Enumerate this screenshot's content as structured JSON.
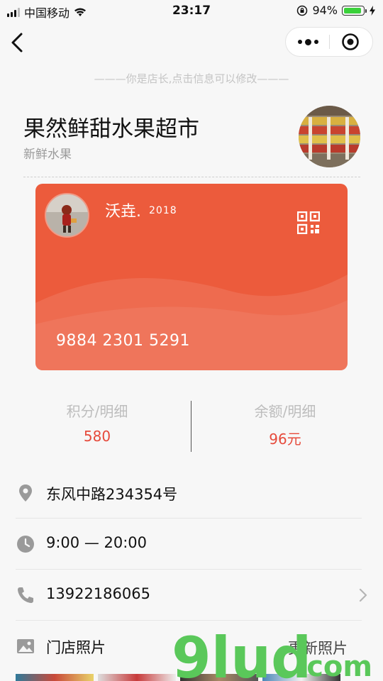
{
  "status_bar": {
    "carrier": "中国移动",
    "time": "23:17",
    "battery": "94%",
    "battery_level": 0.94
  },
  "nav": {
    "back_icon": "chevron-left-icon",
    "more_icon": "more-dots-icon",
    "close_icon": "target-circle-icon"
  },
  "hint": "———你是店长,点击信息可以修改———",
  "store": {
    "name": "果然鲜甜水果超市",
    "category": "新鲜水果"
  },
  "card": {
    "holder_name": "沃垚.",
    "year": "2018",
    "number": "9884 2301 5291",
    "color": "#ec5b3c",
    "qr_icon": "qr-code-icon"
  },
  "stats": {
    "points_label": "积分/明细",
    "points_value": "580",
    "balance_label": "余额/明细",
    "balance_value": "96元"
  },
  "info": {
    "address": "东风中路234354号",
    "hours": "9:00 — 20:00",
    "phone": "13922186065",
    "photos_label": "门店照片",
    "update_photos": "更新照片"
  },
  "watermark": {
    "text": "9lud",
    "domain": ".com"
  },
  "colors": {
    "accent_red": "#e64a3b",
    "watermark_green": "#5ac85a"
  }
}
